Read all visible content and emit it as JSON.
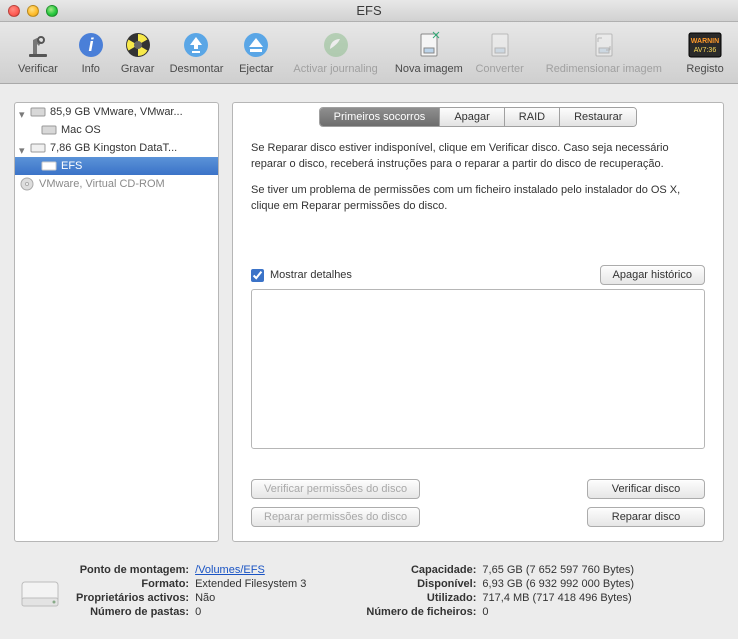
{
  "window": {
    "title": "EFS"
  },
  "toolbar": {
    "verify": "Verificar",
    "info": "Info",
    "burn": "Gravar",
    "unmount": "Desmontar",
    "eject": "Ejectar",
    "enable_journaling": "Activar journaling",
    "new_image": "Nova imagem",
    "convert": "Converter",
    "resize_image": "Redimensionar imagem",
    "log": "Registo"
  },
  "sidebar": {
    "items": [
      {
        "label": "85,9 GB VMware, VMwar...",
        "level": 0,
        "icon": "hdd"
      },
      {
        "label": "Mac OS",
        "level": 1,
        "icon": "hdd"
      },
      {
        "label": "7,86 GB Kingston DataT...",
        "level": 0,
        "icon": "ext"
      },
      {
        "label": "EFS",
        "level": 1,
        "icon": "ext",
        "selected": true
      },
      {
        "label": "VMware, Virtual CD-ROM",
        "level": 0,
        "icon": "cd",
        "dim": true
      }
    ]
  },
  "tabs": {
    "first_aid": "Primeiros socorros",
    "erase": "Apagar",
    "raid": "RAID",
    "restore": "Restaurar"
  },
  "first_aid": {
    "para1": "Se Reparar disco estiver indisponível, clique em Verificar disco. Caso seja necessário reparar o disco, receberá instruções para o reparar a partir do disco de recuperação.",
    "para2": "Se tiver um problema de permissões com um ficheiro instalado pelo instalador do OS X, clique em Reparar permissões do disco.",
    "show_details": "Mostrar detalhes",
    "clear_history": "Apagar histórico",
    "verify_perm": "Verificar permissões do disco",
    "verify_disk": "Verificar disco",
    "repair_perm": "Reparar permissões do disco",
    "repair_disk": "Reparar disco"
  },
  "info": {
    "mount_k": "Ponto de montagem:",
    "mount_v": "/Volumes/EFS",
    "format_k": "Formato:",
    "format_v": "Extended Filesystem 3",
    "owners_k": "Proprietários activos:",
    "owners_v": "Não",
    "folders_k": "Número de pastas:",
    "folders_v": "0",
    "capacity_k": "Capacidade:",
    "capacity_v": "7,65 GB (7 652 597 760 Bytes)",
    "avail_k": "Disponível:",
    "avail_v": "6,93 GB (6 932 992 000 Bytes)",
    "used_k": "Utilizado:",
    "used_v": "717,4 MB (717 418 496 Bytes)",
    "files_k": "Número de ficheiros:",
    "files_v": "0"
  }
}
